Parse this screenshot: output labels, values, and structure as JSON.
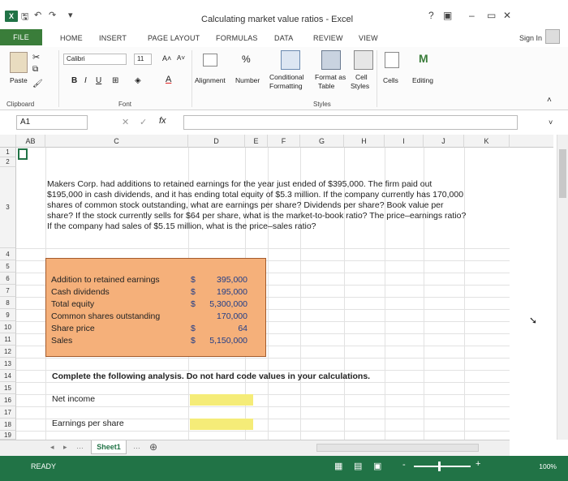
{
  "window": {
    "title": "Calculating market value ratios - Excel",
    "help": "?",
    "minimize": "–",
    "restore": "▭",
    "close": "✕"
  },
  "ribbon_tabs": [
    "FILE",
    "HOME",
    "INSERT",
    "PAGE LAYOUT",
    "FORMULAS",
    "DATA",
    "REVIEW",
    "VIEW"
  ],
  "signin": "Sign In",
  "ribbon": {
    "paste": "Paste",
    "clipboard": "Clipboard",
    "font_name": "Calibri",
    "font_size": "11",
    "bold": "B",
    "italic": "I",
    "underline": "U",
    "font_group": "Font",
    "alignment": "Alignment",
    "number": "Number",
    "percent": "%",
    "conditional_formatting": [
      "Conditional",
      "Formatting"
    ],
    "format_as_table": [
      "Format as",
      "Table"
    ],
    "cell_styles": [
      "Cell",
      "Styles"
    ],
    "styles_group": "Styles",
    "cells": "Cells",
    "editing": "Editing"
  },
  "formula_bar": {
    "name_box": "A1",
    "fx": "fx",
    "value": ""
  },
  "columns": [
    "AB",
    "C",
    "D",
    "E",
    "F",
    "G",
    "H",
    "I",
    "J",
    "K"
  ],
  "rows": [
    "1",
    "2",
    "3",
    "4",
    "5",
    "6",
    "7",
    "8",
    "9",
    "10",
    "11",
    "12",
    "13",
    "14",
    "15",
    "16",
    "17",
    "18",
    "19"
  ],
  "problem_text": "Makers Corp. had additions to retained earnings for the year just ended of $395,000. The firm paid out $195,000 in cash dividends, and it has ending total equity of $5.3 million. If the company currently has 170,000 shares of common stock outstanding, what are earnings per share? Dividends per share? Book value per share? If the stock currently sells for $64 per share, what is the market-to-book ratio? The price–earnings ratio? If the company had sales of $5.15 million, what is the price–sales ratio?",
  "inputs": [
    {
      "label": "Addition to retained earnings",
      "currency": "$",
      "value": "395,000"
    },
    {
      "label": "Cash dividends",
      "currency": "$",
      "value": "195,000"
    },
    {
      "label": "Total equity",
      "currency": "$",
      "value": "5,300,000"
    },
    {
      "label": "Common shares outstanding",
      "currency": "",
      "value": "170,000"
    },
    {
      "label": "Share price",
      "currency": "$",
      "value": "64"
    },
    {
      "label": "Sales",
      "currency": "$",
      "value": "5,150,000"
    }
  ],
  "instruction": "Complete the following analysis. Do not hard code values in your calculations.",
  "analysis": [
    {
      "label": "Net income"
    },
    {
      "label": "Earnings per share"
    }
  ],
  "sheet_tab": "Sheet1",
  "status": {
    "ready": "READY",
    "zoom": "100%"
  }
}
